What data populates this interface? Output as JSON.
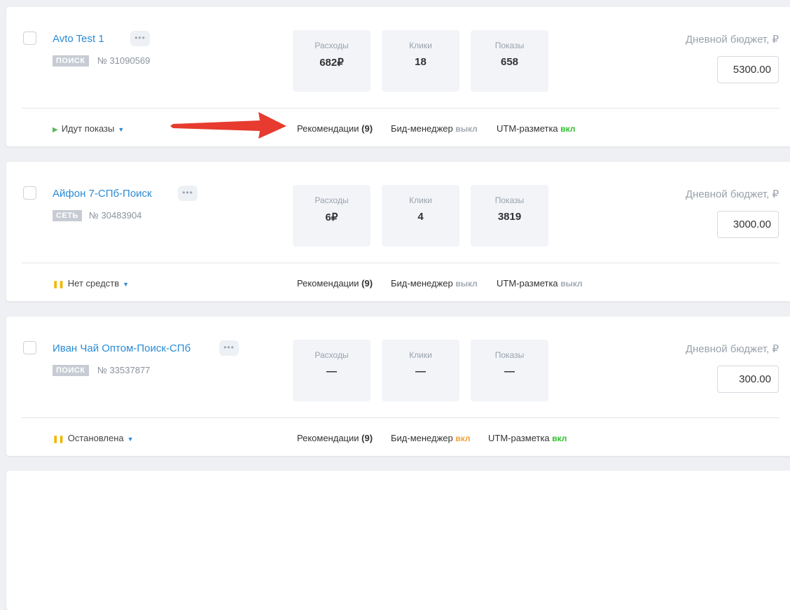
{
  "campaigns": [
    {
      "name": "Avto Test 1",
      "type": "поиск",
      "id": "№ 31090569",
      "stats": [
        {
          "label": "Расходы",
          "value": "682₽"
        },
        {
          "label": "Клики",
          "value": "18"
        },
        {
          "label": "Показы",
          "value": "658"
        }
      ],
      "budget_label": "Дневной бюджет, ₽",
      "budget_value": "5300.00",
      "status_label": "Идут показы",
      "status_color": "#5cb85c",
      "recommendations_label": "Рекомендации",
      "recommendations_count": "(9)",
      "bid_manager_label": "Бид-менеджер",
      "bid_manager_state": "выкл",
      "utm_label": "UTM-разметка",
      "utm_state": "вкл"
    },
    {
      "name": "Айфон 7-СПб-Поиск",
      "type": "сеть",
      "id": "№ 30483904",
      "stats": [
        {
          "label": "Расходы",
          "value": "6₽"
        },
        {
          "label": "Клики",
          "value": "4"
        },
        {
          "label": "Показы",
          "value": "3819"
        }
      ],
      "budget_label": "Дневной бюджет, ₽",
      "budget_value": "3000.00",
      "status_label": "Нет средств",
      "status_color": "#f2b705",
      "recommendations_label": "Рекомендации",
      "recommendations_count": "(9)",
      "bid_manager_label": "Бид-менеджер",
      "bid_manager_state": "выкл",
      "utm_label": "UTM-разметка",
      "utm_state": "выкл"
    },
    {
      "name": "Иван Чай Оптом-Поиск-СПб",
      "type": "поиск",
      "id": "№ 33537877",
      "stats": [
        {
          "label": "Расходы",
          "value": "—"
        },
        {
          "label": "Клики",
          "value": "—"
        },
        {
          "label": "Показы",
          "value": "—"
        }
      ],
      "budget_label": "Дневной бюджет, ₽",
      "budget_value": "300.00",
      "status_label": "Остановлена",
      "status_color": "#f2b705",
      "recommendations_label": "Рекомендации",
      "recommendations_count": "(9)",
      "bid_manager_label": "Бид-менеджер",
      "bid_manager_state": "вкл",
      "utm_label": "UTM-разметка",
      "utm_state": "вкл"
    }
  ],
  "icons": {
    "more": "more-options-icon",
    "play": "play-icon",
    "pause": "pause-icon",
    "caret": "caret-down-icon",
    "annotation": "red-arrow-annotation"
  },
  "colors": {
    "link": "#2a8bd6",
    "on": "#2fc02f",
    "off": "#a2a9b2",
    "orange": "#f0a23a",
    "arrow": "#e63b2e"
  }
}
